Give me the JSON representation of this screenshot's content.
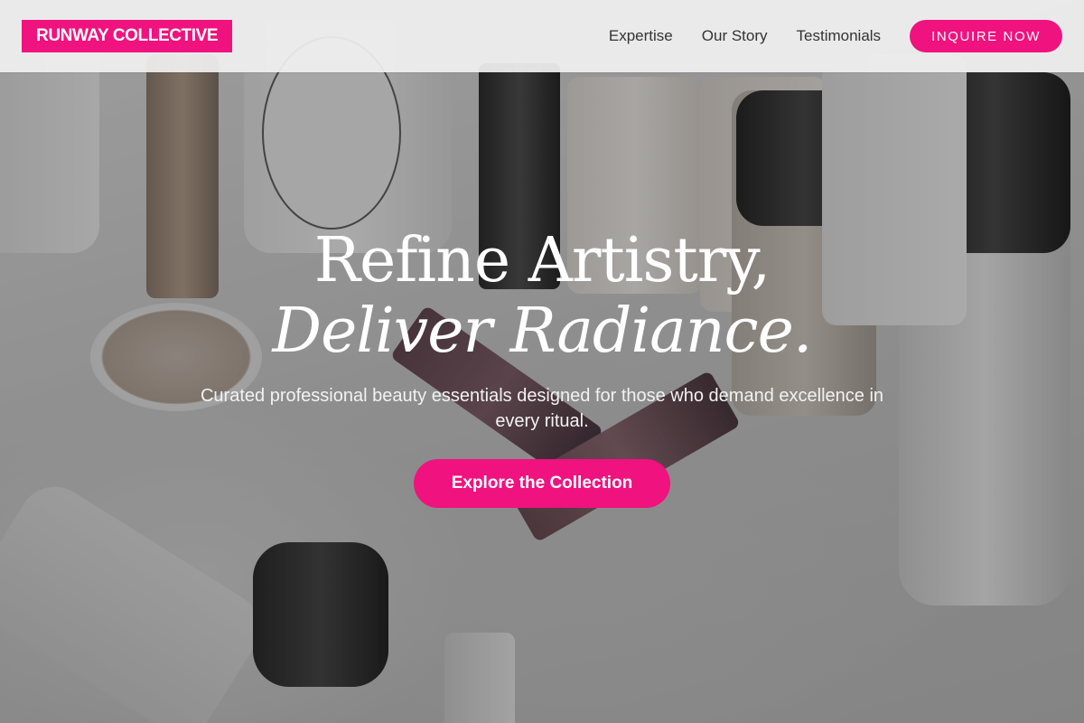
{
  "brand": {
    "name": "RUNWAY COLLECTIVE",
    "accent": "#f0127e"
  },
  "nav": {
    "items": [
      {
        "label": "Expertise"
      },
      {
        "label": "Our Story"
      },
      {
        "label": "Testimonials"
      }
    ],
    "cta_label": "INQUIRE NOW"
  },
  "hero": {
    "headline_line1": "Refine Artistry,",
    "headline_line2": "Deliver Radiance.",
    "subtext": "Curated professional beauty essentials designed for those who demand excellence in every ritual.",
    "button_label": "Explore the Collection"
  }
}
